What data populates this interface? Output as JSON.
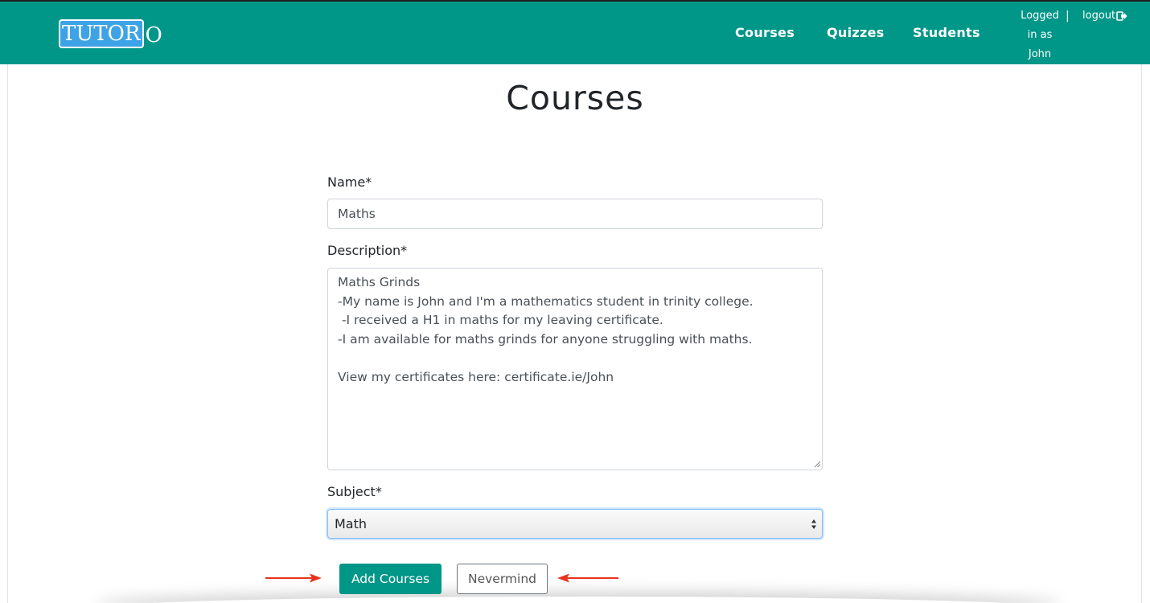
{
  "brand": {
    "logo_boxed": "TUTOR",
    "logo_tail": "O"
  },
  "nav": {
    "courses": "Courses",
    "quizzes": "Quizzes",
    "students": "Students",
    "logged_in_line1": "Logged",
    "logged_in_line2": "in as",
    "logged_in_user": "John",
    "separator": "|",
    "logout": "logout"
  },
  "page": {
    "title": "Courses"
  },
  "form": {
    "name_label": "Name*",
    "name_value": "Maths",
    "description_label": "Description*",
    "description_value": "Maths Grinds\n-My name is John and I'm a mathematics student in trinity college.\n -I received a H1 in maths for my leaving certificate.\n-I am available for maths grinds for anyone struggling with maths.\n\nView my certificates here: certificate.ie/John",
    "subject_label": "Subject*",
    "subject_value": "Math",
    "add_button": "Add Courses",
    "cancel_button": "Nevermind"
  },
  "colors": {
    "brand_teal": "#009688",
    "logo_blue": "#3ea3e6",
    "annotation_arrow_red": "#e8321e"
  },
  "icons": {
    "logout": "logout-icon",
    "select": "select-arrows-icon",
    "annotation": "red-arrow-icon"
  }
}
